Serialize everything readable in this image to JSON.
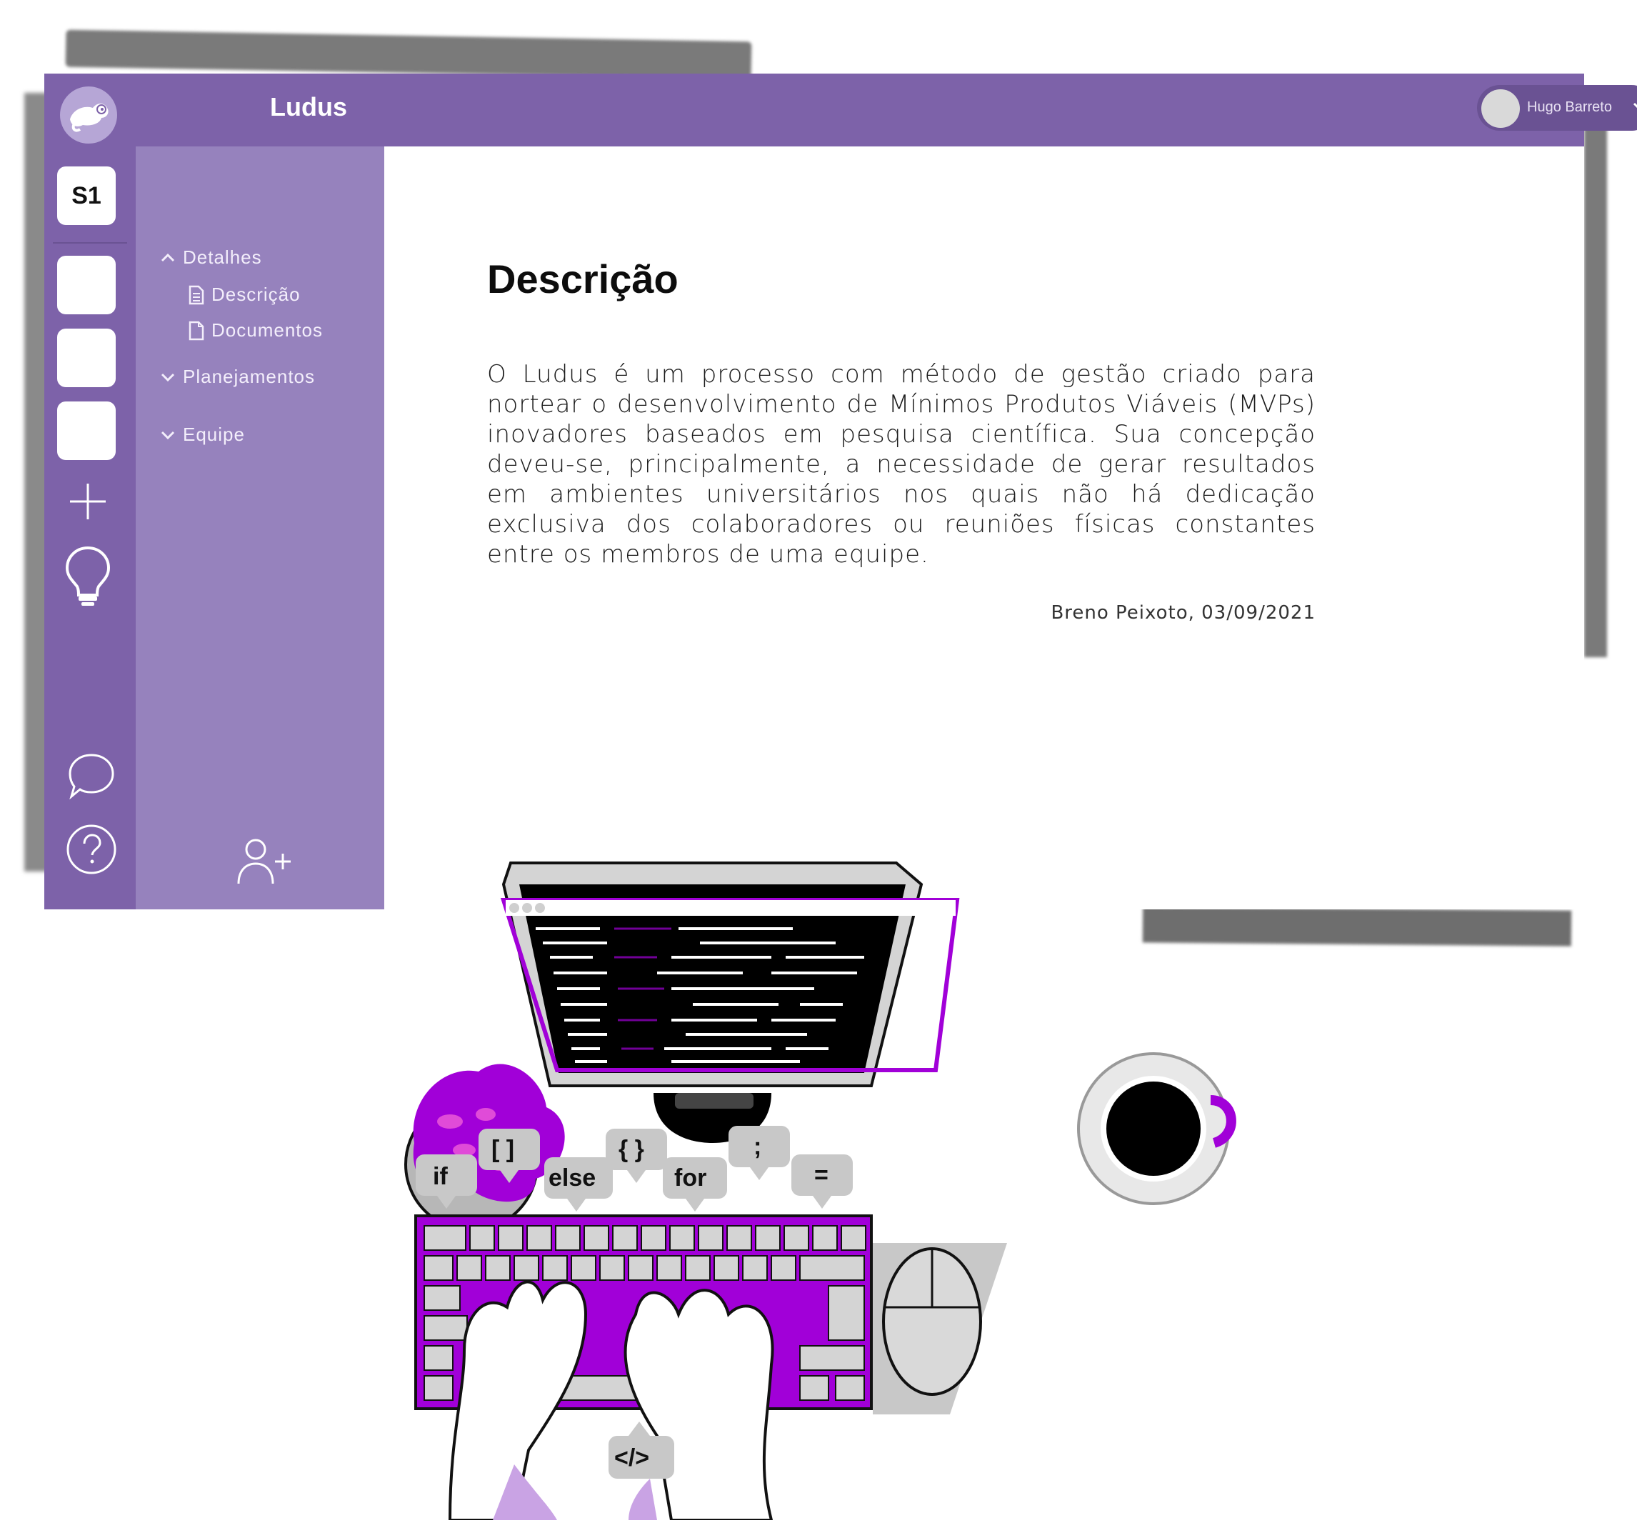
{
  "app": {
    "title": "Ludus"
  },
  "user": {
    "name": "Hugo Barreto"
  },
  "rail": {
    "workspace_label": "S1"
  },
  "sidebar": {
    "sections": [
      {
        "label": "Detalhes",
        "expanded": true,
        "children": [
          {
            "label": "Descrição",
            "icon": "document-text-icon"
          },
          {
            "label": "Documentos",
            "icon": "document-icon"
          }
        ]
      },
      {
        "label": "Planejamentos",
        "expanded": false
      },
      {
        "label": "Equipe",
        "expanded": false
      }
    ]
  },
  "content": {
    "title": "Descrição",
    "body": "O Ludus é um processo com método de gestão criado para nortear o desenvolvimento de Mínimos Produtos Viáveis (MVPs) inovadores baseados em pesquisa científica. Sua concepção deveu-se, principalmente, a necessidade de gerar resultados em ambientes universitários nos quais não há dedicação exclusiva dos colaboradores ou reuniões físicas constantes entre os membros de uma equipe.",
    "author": "Breno Peixoto, 03/09/2021"
  },
  "illustration": {
    "bubbles": [
      "if",
      "[ ]",
      "else",
      "{ }",
      "for",
      ";",
      "=",
      "</>"
    ]
  },
  "colors": {
    "rail": "#7d62a9",
    "sidebar": "#9682bd",
    "accent": "#a100d8"
  }
}
